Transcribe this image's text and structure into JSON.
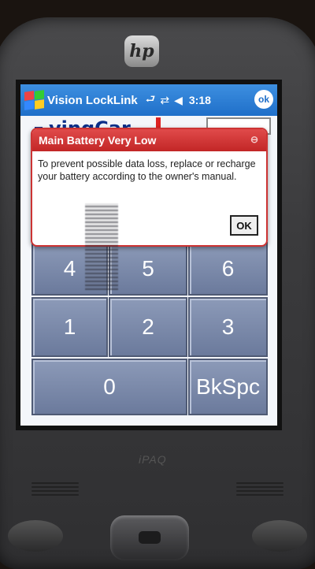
{
  "window": {
    "app_title": "Vision LockLink",
    "time": "3:18",
    "ok_label": "ok",
    "tray_icons": [
      "connectivity-icon",
      "network-icon",
      "volume-icon"
    ]
  },
  "app": {
    "logo_partial_text": "vingCar"
  },
  "dialog": {
    "title": "Main Battery Very Low",
    "message": "To prevent possible data loss, replace or recharge your battery according to the owner's manual.",
    "ok_label": "OK"
  },
  "keypad": {
    "keys": [
      {
        "label": "4"
      },
      {
        "label": "5"
      },
      {
        "label": "6"
      },
      {
        "label": "1"
      },
      {
        "label": "2"
      },
      {
        "label": "3"
      },
      {
        "label": "0"
      },
      {
        "label": "BkSpc"
      }
    ]
  },
  "device": {
    "brand_logo": "hp",
    "model": "iPAQ"
  },
  "colors": {
    "titlebar": "#2a7fd6",
    "dialog_header": "#d23232",
    "key": "#7a88a8"
  }
}
